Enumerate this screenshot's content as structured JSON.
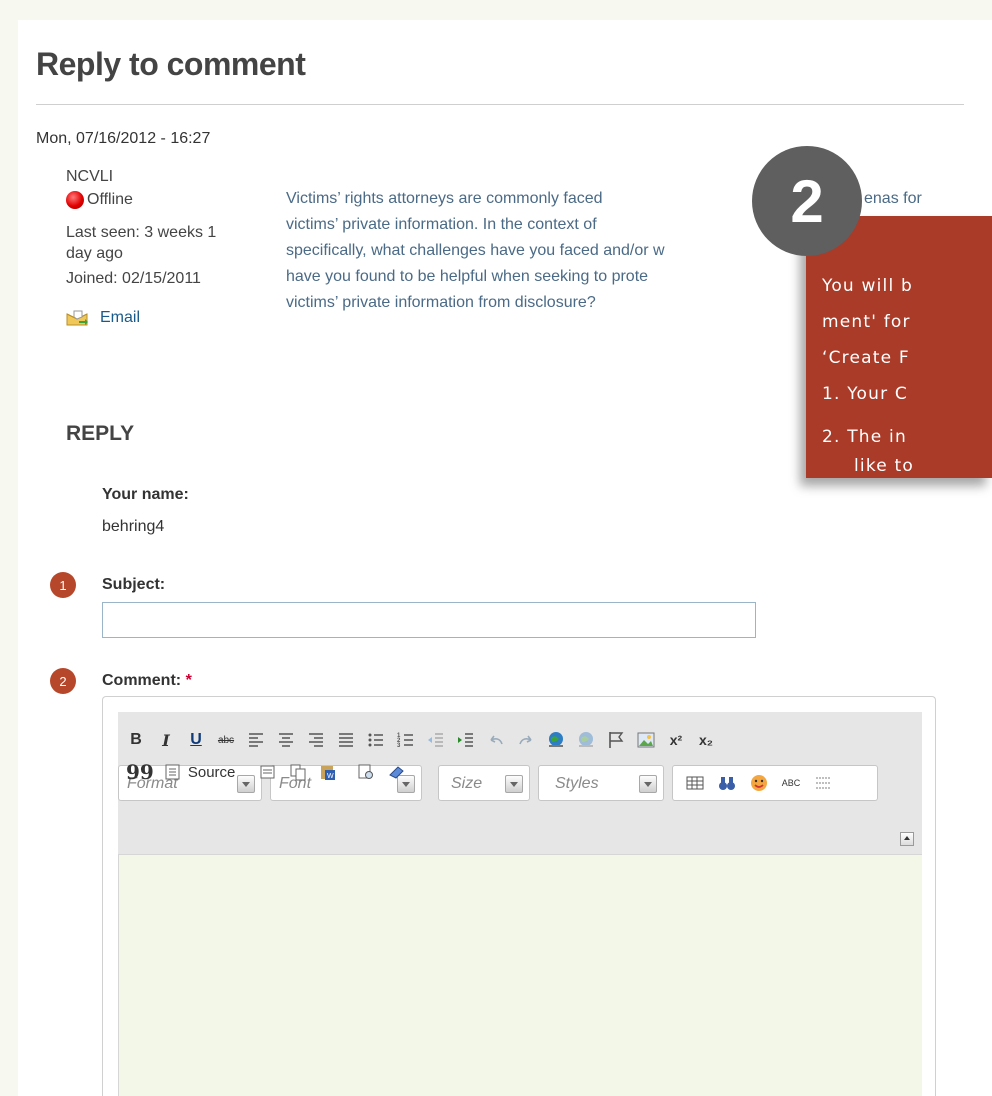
{
  "page": {
    "title": "Reply to comment",
    "date": "Mon, 07/16/2012 - 16:27"
  },
  "author": {
    "name": "NCVLI",
    "status": "Offline",
    "last_seen_1": "Last seen: 3 weeks 1",
    "last_seen_2": "day ago",
    "joined": "Joined: 02/15/2011",
    "email_label": "Email"
  },
  "comment": {
    "lines": [
      "Victims’ rights attorneys are commonly faced ",
      "victims’ private information.  In the context of ",
      "specifically, what challenges have you faced and/or w",
      "have you found to be helpful when seeking to prote",
      "victims’ private information from disclosure?"
    ],
    "fragment_right": "enas for"
  },
  "reply": {
    "heading": "REPLY",
    "name_label": "Your name:",
    "name_value": "behring4",
    "subject_label": "Subject:",
    "subject_value": "",
    "comment_label": "Comment:",
    "required_mark": "*"
  },
  "markers": {
    "subject": "1",
    "comment": "2",
    "callout": "2"
  },
  "editor": {
    "toolbar_row1": [
      {
        "icon": "bold-icon",
        "glyph": "B"
      },
      {
        "icon": "italic-icon",
        "glyph": "I"
      },
      {
        "icon": "underline-icon",
        "glyph": "U"
      },
      {
        "icon": "strikethrough-icon",
        "glyph": "abc"
      },
      {
        "icon": "align-left-icon",
        "glyph": ""
      },
      {
        "icon": "align-center-icon",
        "glyph": ""
      },
      {
        "icon": "align-right-icon",
        "glyph": ""
      },
      {
        "icon": "justify-icon",
        "glyph": ""
      },
      {
        "icon": "bulleted-list-icon",
        "glyph": ""
      },
      {
        "icon": "numbered-list-icon",
        "glyph": ""
      },
      {
        "icon": "outdent-icon",
        "glyph": ""
      },
      {
        "icon": "indent-icon",
        "glyph": ""
      },
      {
        "icon": "undo-icon",
        "glyph": ""
      },
      {
        "icon": "redo-icon",
        "glyph": ""
      },
      {
        "icon": "link-icon",
        "glyph": ""
      },
      {
        "icon": "unlink-icon",
        "glyph": ""
      },
      {
        "icon": "anchor-flag-icon",
        "glyph": ""
      },
      {
        "icon": "image-icon",
        "glyph": ""
      },
      {
        "icon": "superscript-icon",
        "glyph": "x²"
      },
      {
        "icon": "subscript-icon",
        "glyph": "x₂"
      }
    ],
    "blockquote_glyph": "99",
    "source_label": "Source",
    "combos": {
      "format": "Format",
      "font": "Font",
      "size": "Size",
      "styles": "Styles"
    },
    "spellcheck_glyph": "ABC",
    "accent": "#a93b28"
  },
  "callout": {
    "line1": "You will b",
    "line2": "ment' for",
    "line3": "‘Create F",
    "item1": "1.  Your C",
    "item2a": "2.  The in",
    "item2b": "like to"
  }
}
